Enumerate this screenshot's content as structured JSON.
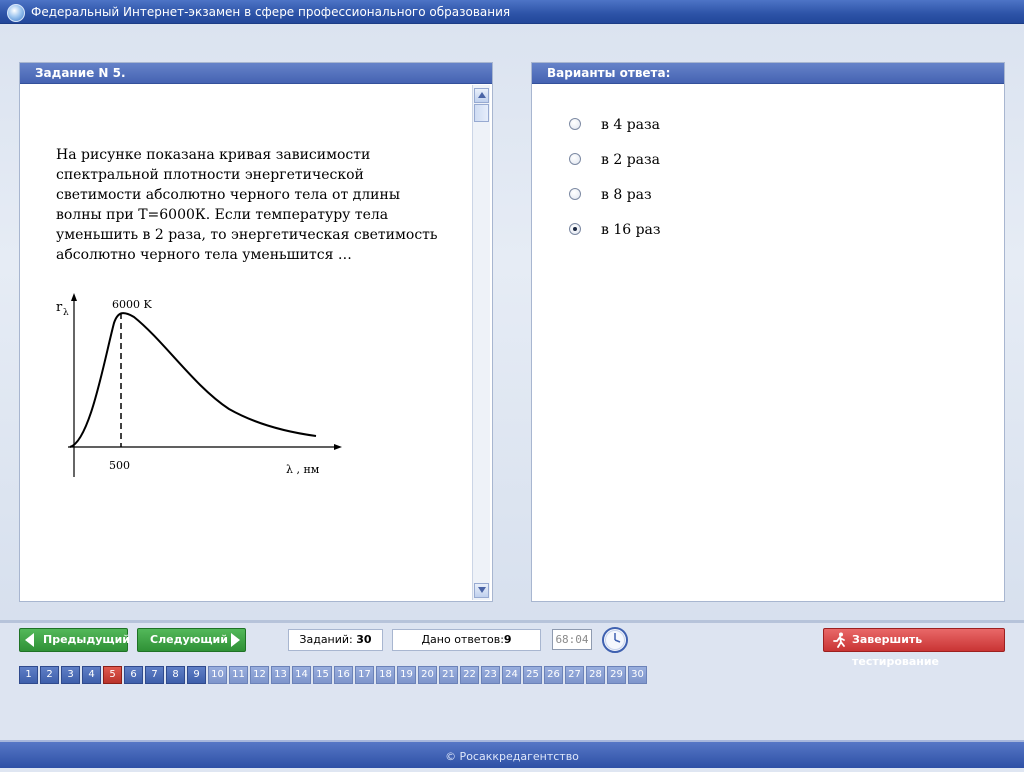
{
  "window": {
    "title": "Федеральный Интернет-экзамен в сфере профессионального образования"
  },
  "task": {
    "header": "Задание N 5.",
    "question": "На рисунке показана кривая зависимости спектральной плотности энергетической светимости абсолютно черного тела от длины волны при Т=6000К. Если температуру тела уменьшить в 2 раза, то энергетическая светимость абсолютно черного тела уменьшится …",
    "figure": {
      "y_label": "r",
      "y_label_sub": "λ",
      "peak_label": "6000 K",
      "x_tick": "500",
      "x_label": "λ , нм"
    }
  },
  "answers": {
    "header": "Варианты ответа:",
    "options": [
      {
        "label": "в 4 раза",
        "selected": false
      },
      {
        "label": "в 2 раза",
        "selected": false
      },
      {
        "label": "в 8 раз",
        "selected": false
      },
      {
        "label": "в 16 раз",
        "selected": true
      }
    ]
  },
  "nav": {
    "prev_label": "Предыдущий",
    "next_label": "Следующий",
    "finish_label": "Завершить тестирование"
  },
  "status": {
    "tasks_label": "Заданий:",
    "tasks_count": "30",
    "answered_label": "Дано ответов:",
    "answered_count": "9",
    "timer": "68:04"
  },
  "pages": {
    "current": 5,
    "visited_upto": 9,
    "items": [
      "1",
      "2",
      "3",
      "4",
      "5",
      "6",
      "7",
      "8",
      "9",
      "10",
      "11",
      "12",
      "13",
      "14",
      "15",
      "16",
      "17",
      "18",
      "19",
      "20",
      "21",
      "22",
      "23",
      "24",
      "25",
      "26",
      "27",
      "28",
      "29",
      "30"
    ]
  },
  "footer": {
    "text": "© Росаккредагентство"
  },
  "colors": {
    "title_bar": "#2d53a7",
    "panel_header": "#4563b2",
    "nav_green": "#2f9136",
    "finish_red": "#c93434",
    "page_current": "#b9322a"
  }
}
